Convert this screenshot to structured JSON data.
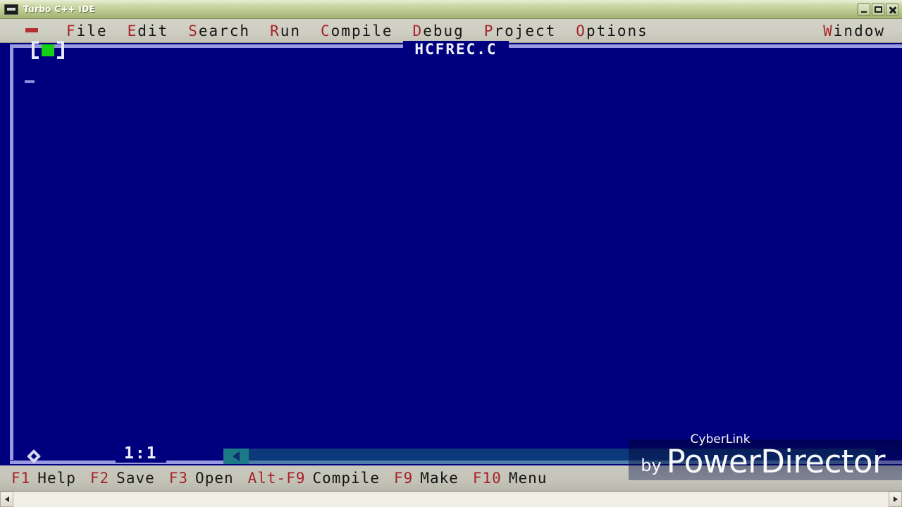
{
  "window": {
    "title": "Turbo C++ IDE",
    "icon": "dos-app-icon",
    "controls": {
      "minimize": "minimize-icon",
      "maximize": "maximize-icon",
      "close": "close-icon"
    }
  },
  "menubar": {
    "system_menu": "≡",
    "items": [
      {
        "hot": "F",
        "rest": "ile"
      },
      {
        "hot": "E",
        "rest": "dit"
      },
      {
        "hot": "S",
        "rest": "earch"
      },
      {
        "hot": "R",
        "rest": "un"
      },
      {
        "hot": "C",
        "rest": "ompile"
      },
      {
        "hot": "D",
        "rest": "ebug"
      },
      {
        "hot": "P",
        "rest": "roject"
      },
      {
        "hot": "O",
        "rest": "ptions"
      },
      {
        "hot": "W",
        "rest": "indow"
      }
    ]
  },
  "editor": {
    "filename": "HCFREC.C",
    "close_box": "[■]",
    "cursor_position": "1:1",
    "content": "",
    "colors": {
      "background": "#00007e",
      "border": "#9a9ae2",
      "close_square": "#16d016",
      "scrollbar": "#1b7a86"
    }
  },
  "function_keys": [
    {
      "key": "F1",
      "label": "Help"
    },
    {
      "key": "F2",
      "label": "Save"
    },
    {
      "key": "F3",
      "label": "Open"
    },
    {
      "key": "Alt-F9",
      "label": "Compile"
    },
    {
      "key": "F9",
      "label": "Make"
    },
    {
      "key": "F10",
      "label": "Menu"
    }
  ],
  "watermark": {
    "by": "by",
    "brand": "CyberLink",
    "product": "PowerDirector"
  },
  "colors": {
    "menu_hotkey": "#a5232a",
    "titlebar": "#b9c78d",
    "menubar": "#cfcec2",
    "desktop": "#00007e"
  }
}
